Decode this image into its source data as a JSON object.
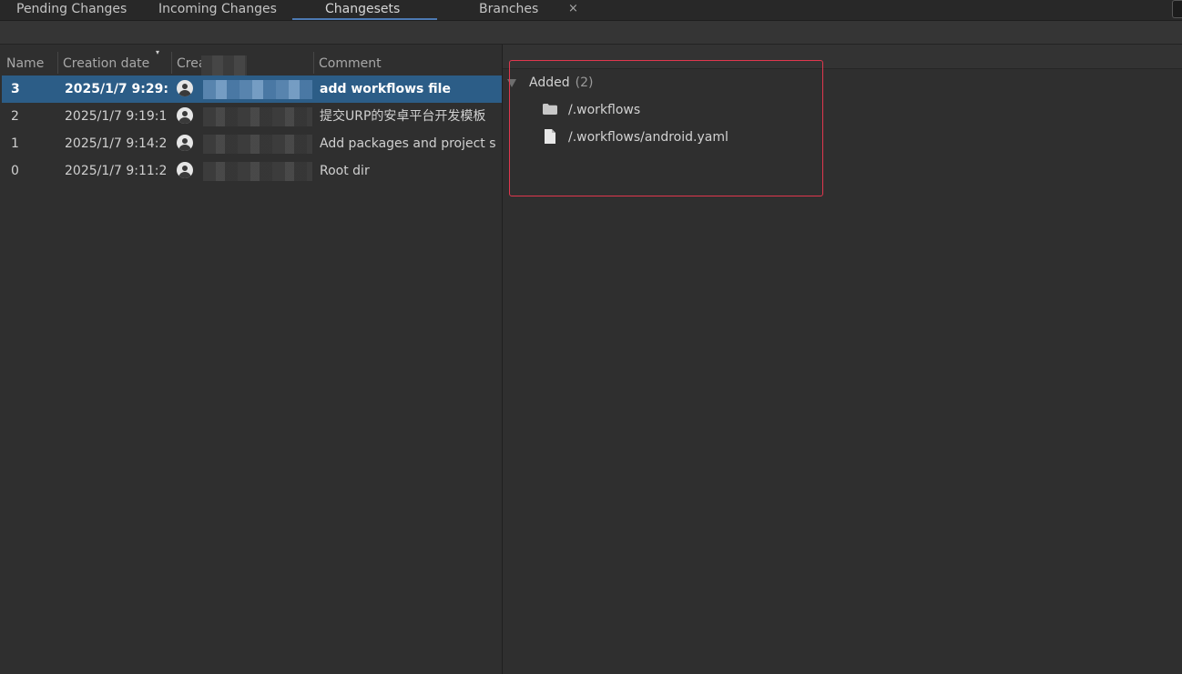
{
  "tabs": [
    {
      "label": "Pending Changes",
      "active": false
    },
    {
      "label": "Incoming Changes",
      "active": false
    },
    {
      "label": "Changesets",
      "active": true
    },
    {
      "label": "Branches",
      "active": false
    }
  ],
  "tab_close": "×",
  "columns": {
    "name": "Name",
    "creation_date": "Creation date",
    "created_by": "Crea",
    "comment": "Comment",
    "sort_indicator": "▾"
  },
  "changesets": [
    {
      "name": "3",
      "date": "2025/1/7 9:29:(",
      "comment": "add workflows file",
      "selected": true
    },
    {
      "name": "2",
      "date": "2025/1/7 9:19:1:",
      "comment": "提交URP的安卓平台开发模板",
      "selected": false
    },
    {
      "name": "1",
      "date": "2025/1/7 9:14:2",
      "comment": "Add packages and project s",
      "selected": false
    },
    {
      "name": "0",
      "date": "2025/1/7 9:11:2:",
      "comment": "Root dir",
      "selected": false
    }
  ],
  "details": {
    "group_label": "Added",
    "group_count": "(2)",
    "items": [
      {
        "path": "/.workflows",
        "icon": "folder-icon"
      },
      {
        "path": "/.workflows/android.yaml",
        "icon": "file-icon"
      }
    ]
  },
  "colors": {
    "accent": "#2c5d87",
    "tab_underline": "#4d7ab3",
    "highlight_box": "#e0374e"
  }
}
